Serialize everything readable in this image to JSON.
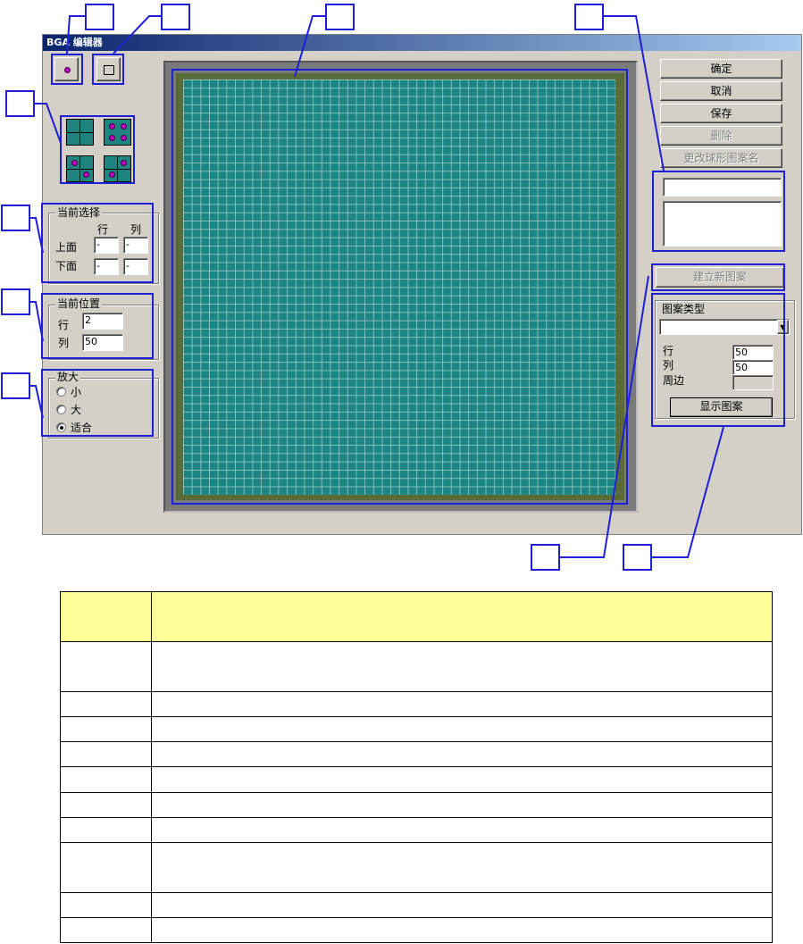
{
  "window": {
    "title": "BGA 编辑器"
  },
  "buttons": {
    "ok": "确定",
    "cancel": "取消",
    "save": "保存",
    "delete": "删除",
    "rename": "更改球形图案名",
    "create_new": "建立新图案",
    "show_pattern": "显示图案"
  },
  "current_selection": {
    "title": "当前选择",
    "col_header_row": "行",
    "col_header_col": "列",
    "top_label": "上面",
    "bottom_label": "下面",
    "top_row": "-",
    "top_col": "-",
    "bottom_row": "-",
    "bottom_col": "-"
  },
  "current_position": {
    "title": "当前位置",
    "row_label": "行",
    "col_label": "列",
    "row_value": "2",
    "col_value": "50"
  },
  "zoom": {
    "title": "放大",
    "options": [
      "小",
      "大",
      "适合"
    ],
    "selected": "适合"
  },
  "pattern_type": {
    "title": "图案类型",
    "selected": "",
    "row_label": "行",
    "col_label": "列",
    "perimeter_label": "周边",
    "row_value": "50",
    "col_value": "50",
    "perimeter_value": ""
  },
  "pattern_name": {
    "value": ""
  },
  "pattern_list": {
    "items": []
  },
  "grid": {
    "rows": 50,
    "cols": 50,
    "cell_color": "#1b8683",
    "border_color": "#5a6b3a"
  },
  "highlight_color": "#1f1fd6",
  "table": {
    "header_color": "#ffff99",
    "row_count": 11
  }
}
